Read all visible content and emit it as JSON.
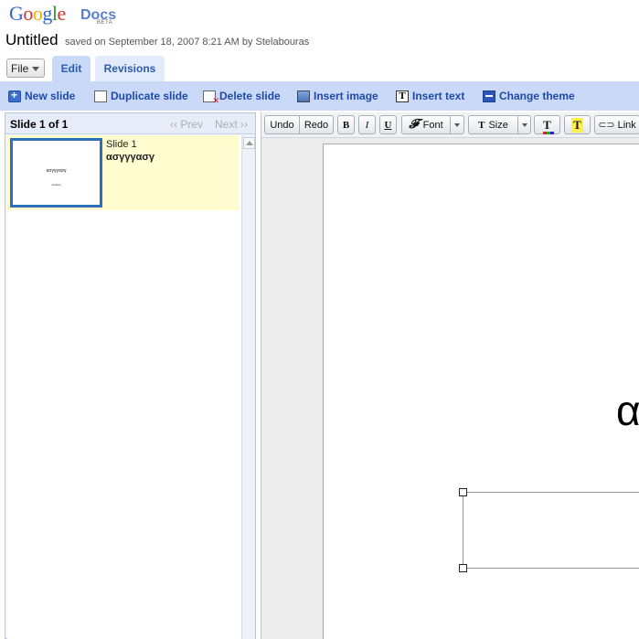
{
  "brand": {
    "logo_google": "Google",
    "logo_docs": "Docs",
    "logo_beta": "BETA"
  },
  "document": {
    "title": "Untitled",
    "saved_info": "saved on September 18, 2007 8:21 AM by Stelabouras"
  },
  "menu": {
    "file_label": "File"
  },
  "tabs": [
    {
      "label": "Edit",
      "active": true
    },
    {
      "label": "Revisions",
      "active": false
    }
  ],
  "actions": {
    "new_slide": "New slide",
    "duplicate_slide": "Duplicate slide",
    "delete_slide": "Delete slide",
    "insert_image": "Insert image",
    "insert_text": "Insert text",
    "change_theme": "Change theme"
  },
  "slide_panel": {
    "count": "Slide 1 of 1",
    "prev": "‹‹ Prev",
    "next": "Next ››",
    "slides": [
      {
        "label": "Slide 1",
        "text": "ασγγγασγ",
        "thumb_title": "ασγγγασγ",
        "thumb_sub": "aaaaaa"
      }
    ]
  },
  "toolbar": {
    "undo": "Undo",
    "redo": "Redo",
    "bold": "B",
    "italic": "I",
    "underline": "U",
    "font": "Font",
    "size": "Size",
    "link": "Link",
    "font_icon": "𝓕",
    "size_icon": "T",
    "text_color_icon": "T",
    "highlight_icon": "T",
    "link_icon": "⊂⊃"
  },
  "canvas": {
    "title_text": "α"
  },
  "colors": {
    "accent": "#c9d9f7",
    "link": "#1f4aa8",
    "selected_slide": "#fffdd0",
    "thumb_border": "#2d6fb8"
  }
}
